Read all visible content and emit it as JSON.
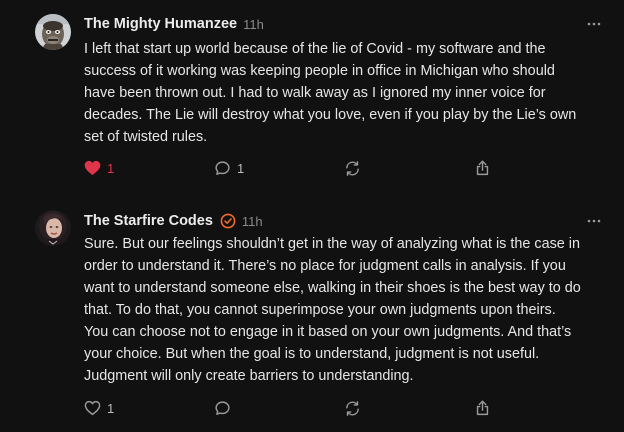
{
  "posts": [
    {
      "author": "The Mighty Humanzee",
      "time": "11h",
      "verified": false,
      "lines": [
        "I left that start up world because of the lie of Covid - my software and the",
        "success of it working was keeping people in office in Michigan who should",
        "have been thrown out. I had to walk away as I ignored my inner voice for",
        "decades. The Lie will destroy what you love, even if you play by the Lie’s own",
        "set of twisted rules."
      ],
      "likes": "1",
      "liked": true,
      "comments": "1"
    },
    {
      "author": "The Starfire Codes",
      "time": "11h",
      "verified": true,
      "lines": [
        "Sure. But our feelings shouldn’t get in the way of analyzing what is the case in",
        "order to understand it. There’s no place for judgment calls in analysis. If you",
        "want to understand someone else, walking in their shoes is the best way to do",
        "that. To do that, you cannot superimpose your own judgments upon theirs.",
        "You can choose not to engage in it based on your own judgments. And that’s",
        "your choice. But when the goal is to understand, judgment is not useful.",
        "Judgment will only create barriers to understanding."
      ],
      "likes": "1",
      "liked": false,
      "comments": ""
    }
  ],
  "colors": {
    "background": "#111111",
    "like_active": "#e0344a",
    "verified_badge": "#f26b2a",
    "icon": "#9a9a9a"
  },
  "icons": [
    "more-icon",
    "heart-icon",
    "comment-icon",
    "repost-icon",
    "share-icon",
    "verified-badge-icon"
  ]
}
